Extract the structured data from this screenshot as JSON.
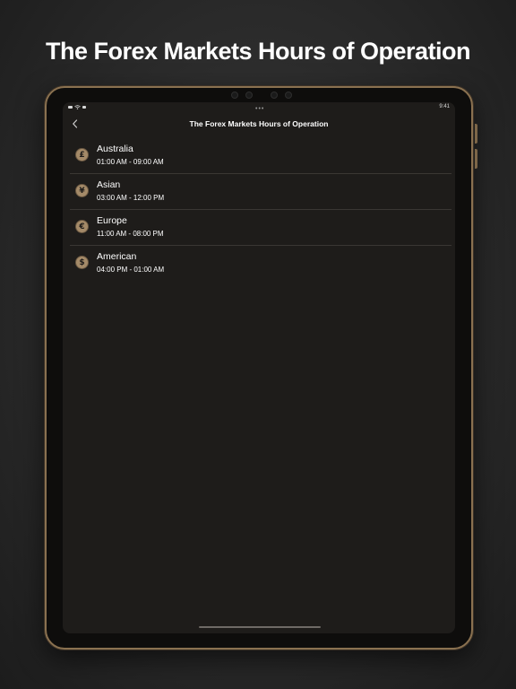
{
  "headline": "The Forex Markets Hours of Operation",
  "status_bar": {
    "time": "9:41",
    "multitask": "•••"
  },
  "nav": {
    "back_icon": "chevron-left-icon",
    "title": "The Forex Markets Hours of Operation"
  },
  "markets": [
    {
      "name": "Australia",
      "hours": "01:00 AM - 09:00 AM",
      "icon": "pound-icon",
      "symbol": "£"
    },
    {
      "name": "Asian",
      "hours": "03:00 AM - 12:00 PM",
      "icon": "yen-icon",
      "symbol": "¥"
    },
    {
      "name": "Europe",
      "hours": "11:00 AM - 08:00 PM",
      "icon": "euro-icon",
      "symbol": "€"
    },
    {
      "name": "American",
      "hours": "04:00 PM - 01:00 AM",
      "icon": "dollar-icon",
      "symbol": "$"
    }
  ],
  "colors": {
    "accent_gold": "#a48a68",
    "background": "#1e1c1a",
    "frame": "#8a7150"
  }
}
